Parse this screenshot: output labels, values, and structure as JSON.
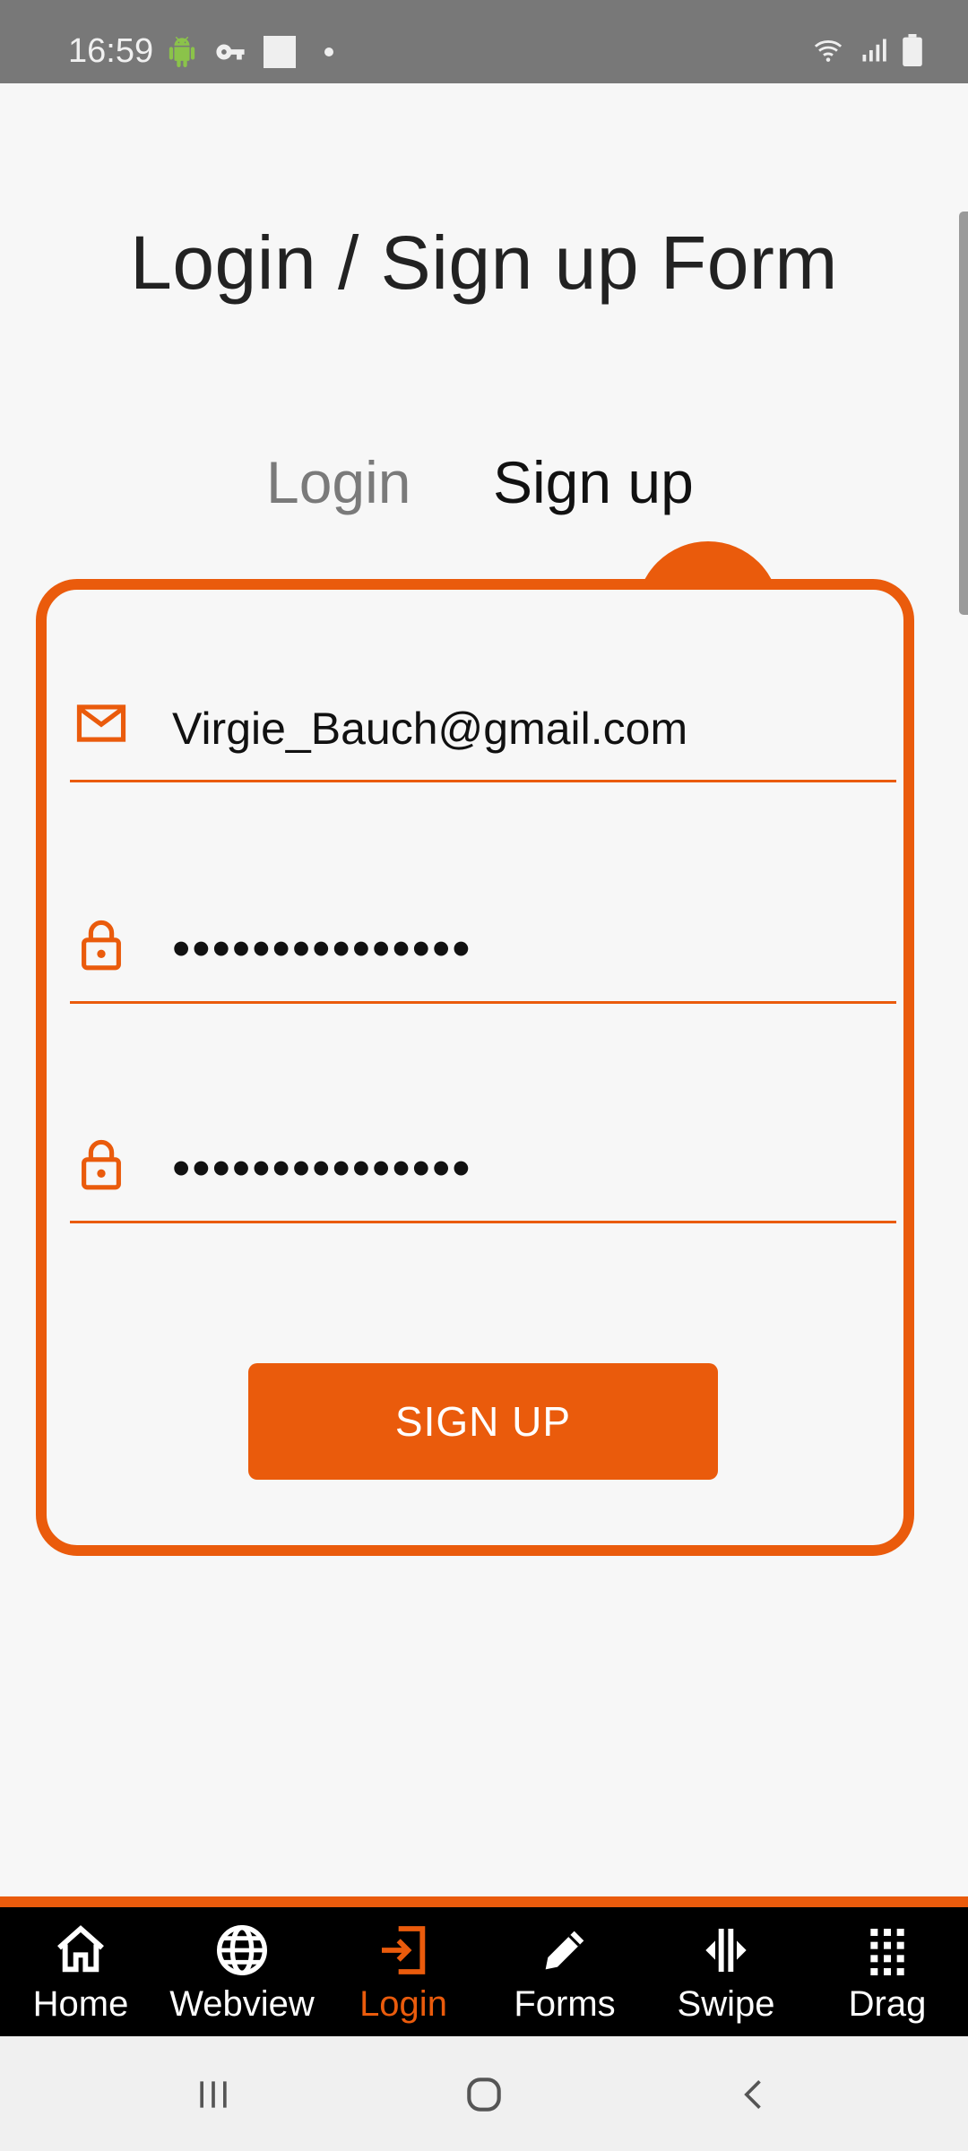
{
  "status_bar": {
    "time": "16:59"
  },
  "page": {
    "title": "Login / Sign up Form"
  },
  "tabs": [
    {
      "label": "Login",
      "active": false
    },
    {
      "label": "Sign up",
      "active": true
    }
  ],
  "form": {
    "email": "Virgie_Bauch@gmail.com",
    "password_mask": "•••••••••••••••",
    "confirm_password_mask": "•••••••••••••••",
    "submit_label": "SIGN UP"
  },
  "bottom_nav": [
    {
      "label": "Home",
      "icon": "home-icon"
    },
    {
      "label": "Webview",
      "icon": "globe-icon"
    },
    {
      "label": "Login",
      "icon": "login-icon",
      "active": true
    },
    {
      "label": "Forms",
      "icon": "pencil-icon"
    },
    {
      "label": "Swipe",
      "icon": "swipe-icon"
    },
    {
      "label": "Drag",
      "icon": "grid-icon"
    }
  ],
  "colors": {
    "accent": "#ea5b0c",
    "status_bar": "#787878",
    "background": "#f7f7f7",
    "nav_background": "#000000"
  }
}
